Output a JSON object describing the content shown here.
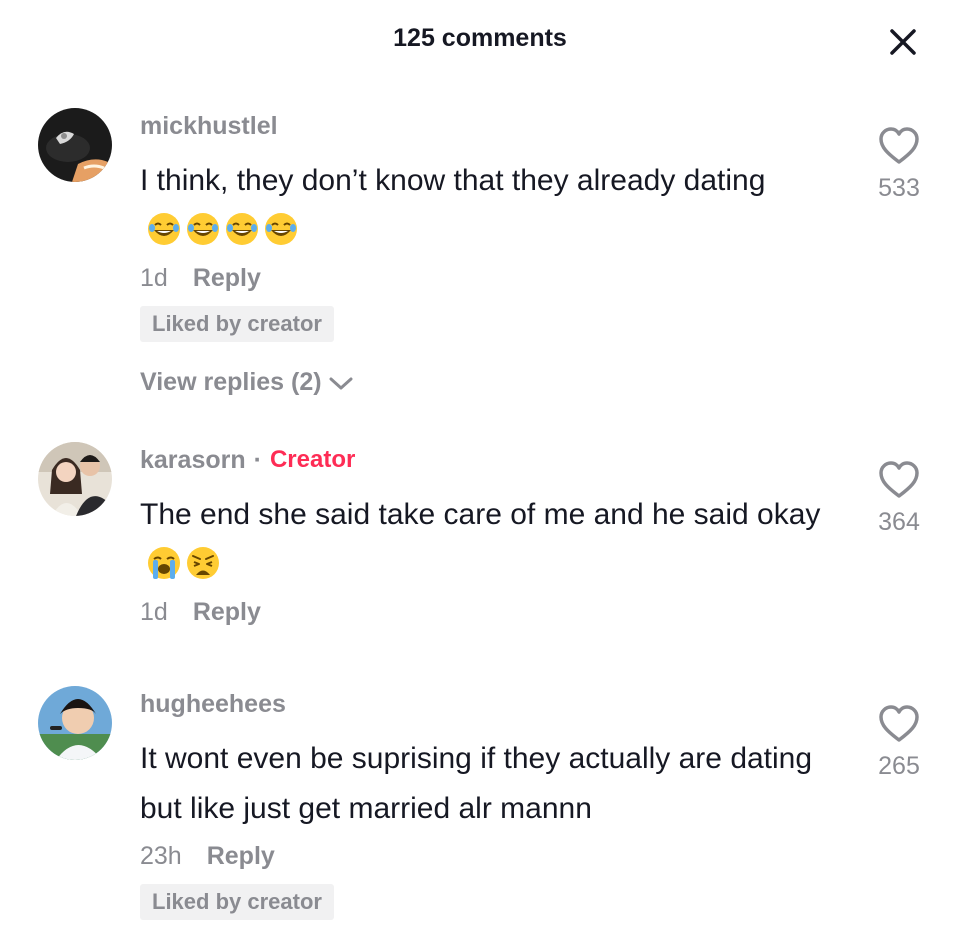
{
  "header": {
    "title": "125 comments",
    "close_icon": "close-icon"
  },
  "comments": [
    {
      "username": "mickhustlel",
      "text": "I think, they don’t know that they already dating",
      "emojis": [
        "laughing-tears-emoji",
        "laughing-tears-emoji",
        "laughing-tears-emoji",
        "laughing-tears-emoji"
      ],
      "time": "1d",
      "reply_label": "Reply",
      "liked_badge": "Liked by creator",
      "view_replies": "View replies (2)",
      "likes": "533"
    },
    {
      "username": "karasorn",
      "separator": "·",
      "creator_label": "Creator",
      "text": "The end she said take care of me and he said okay",
      "emojis": [
        "loudly-crying-emoji",
        "weary-emoji"
      ],
      "time": "1d",
      "reply_label": "Reply",
      "likes": "364"
    },
    {
      "username": "hugheehees",
      "text": "It wont even be suprising if they actually are dating but like just get married alr mannn",
      "time": "23h",
      "reply_label": "Reply",
      "liked_badge": "Liked by creator",
      "likes": "265"
    }
  ],
  "colors": {
    "text_primary": "#161823",
    "text_secondary": "#8a8b91",
    "creator_accent": "#fe2c55",
    "badge_bg": "#f1f1f2"
  }
}
